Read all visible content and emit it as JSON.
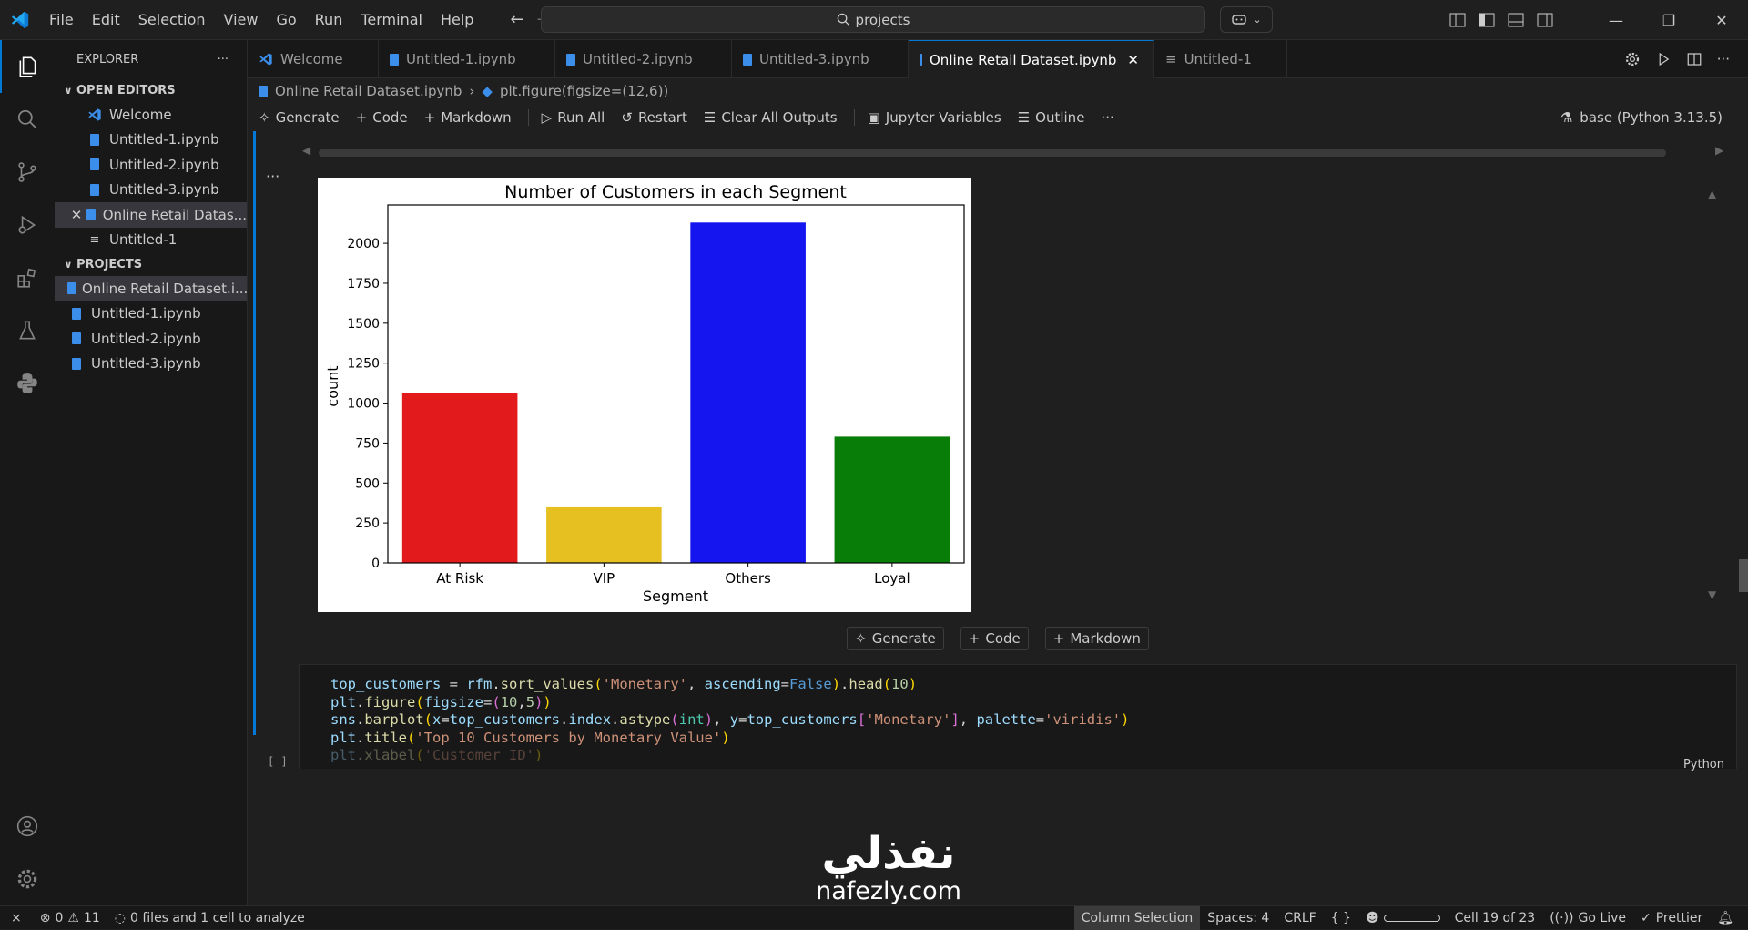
{
  "menu": [
    "File",
    "Edit",
    "Selection",
    "View",
    "Go",
    "Run",
    "Terminal",
    "Help"
  ],
  "search": {
    "text": "projects"
  },
  "explorer": {
    "title": "EXPLORER",
    "open_editors_title": "OPEN EDITORS",
    "open_editors": [
      "Welcome",
      "Untitled-1.ipynb",
      "Untitled-2.ipynb",
      "Untitled-3.ipynb",
      "Online Retail Datas...",
      "Untitled-1"
    ],
    "projects_title": "PROJECTS",
    "projects": [
      "Online Retail Dataset.i...",
      "Untitled-1.ipynb",
      "Untitled-2.ipynb",
      "Untitled-3.ipynb"
    ]
  },
  "tabs": [
    "Welcome",
    "Untitled-1.ipynb",
    "Untitled-2.ipynb",
    "Untitled-3.ipynb",
    "Online Retail Dataset.ipynb",
    "Untitled-1"
  ],
  "breadcrumb": {
    "file": "Online Retail Dataset.ipynb",
    "symbol": "plt.figure(figsize=(12,6))"
  },
  "toolbar": {
    "generate": "Generate",
    "code": "Code",
    "markdown": "Markdown",
    "run_all": "Run All",
    "restart": "Restart",
    "clear": "Clear All Outputs",
    "variables": "Jupyter Variables",
    "outline": "Outline",
    "kernel": "base (Python 3.13.5)"
  },
  "add_cell": {
    "generate": "Generate",
    "code": "Code",
    "markdown": "Markdown"
  },
  "chart_data": {
    "type": "bar",
    "title": "Number of Customers in each Segment",
    "xlabel": "Segment",
    "ylabel": "count",
    "categories": [
      "At Risk",
      "VIP",
      "Others",
      "Loyal"
    ],
    "values": [
      1065,
      348,
      2130,
      790
    ],
    "colors": [
      "#e31a1c",
      "#e6c020",
      "#1515f0",
      "#087d08"
    ],
    "ylim": [
      0,
      2240
    ],
    "yticks": [
      "0",
      "250",
      "500",
      "750",
      "1000",
      "1250",
      "1500",
      "1750",
      "2000"
    ],
    "grid": false
  },
  "code_lines": [
    "top_customers = rfm.sort_values('Monetary', ascending=False).head(10)",
    "plt.figure(figsize=(10,5))",
    "sns.barplot(x=top_customers.index.astype(int), y=top_customers['Monetary'], palette='viridis')",
    "plt.title('Top 10 Customers by Monetary Value')",
    "plt.xlabel('Customer ID')"
  ],
  "cell": {
    "exec_count": "[ ]",
    "language": "Python"
  },
  "status": {
    "errors": "0",
    "warnings": "11",
    "analysis": "0 files and 1 cell to analyze",
    "column_selection": "Column Selection",
    "spaces": "Spaces: 4",
    "eol": "CRLF",
    "braces": "{ }",
    "cell_pos": "Cell 19 of 23",
    "go_live": "Go Live",
    "prettier": "Prettier"
  },
  "watermark": {
    "arabic": "نفذلي",
    "latin": "nafezly.com"
  }
}
